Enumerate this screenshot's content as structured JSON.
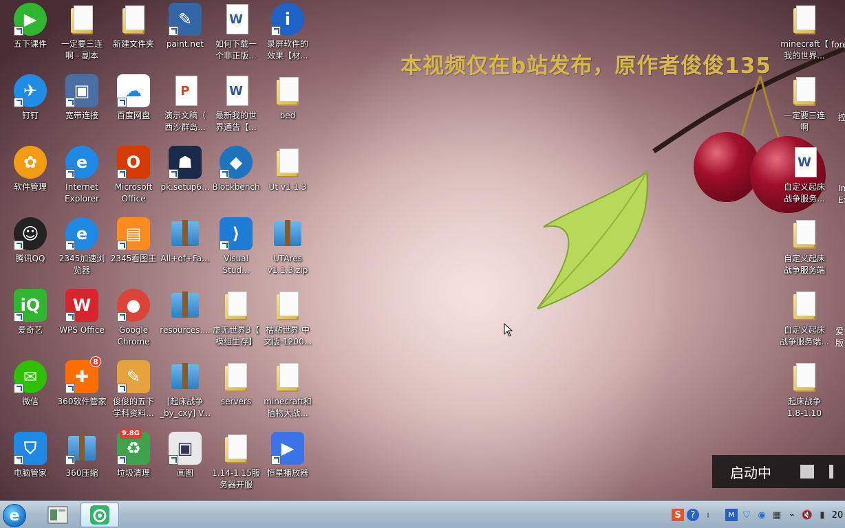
{
  "watermark": "本视频仅在b站发布，原作者俊俊135",
  "desktop_icons": [
    {
      "label": "五下课件"
    },
    {
      "label": "一定要三连\n啊 - 副本"
    },
    {
      "label": "新建文件夹"
    },
    {
      "label": "paint.net"
    },
    {
      "label": "如何下载一\n个非正版..."
    },
    {
      "label": "录屏软件的\n效果【材..."
    },
    {
      "label": "钉钉"
    },
    {
      "label": "宽带连接"
    },
    {
      "label": "百度网盘"
    },
    {
      "label": "演示文稿（\n西沙群岛..."
    },
    {
      "label": "最新我的世\n界通告【..."
    },
    {
      "label": "bed"
    },
    {
      "label": "软件管理"
    },
    {
      "label": "Internet\nExplorer"
    },
    {
      "label": "Microsoft\nOffice"
    },
    {
      "label": "pk.setup6..."
    },
    {
      "label": "Blockbench"
    },
    {
      "label": "Ut v1.1.3"
    },
    {
      "label": "腾讯QQ"
    },
    {
      "label": "2345加速浏\n览器"
    },
    {
      "label": "2345看图王"
    },
    {
      "label": "All+of+Fa..."
    },
    {
      "label": "Visual\nStud..."
    },
    {
      "label": "UTAres\nv1.1.3.zip"
    },
    {
      "label": "爱奇艺"
    },
    {
      "label": "WPS Office"
    },
    {
      "label": "Google\nChrome"
    },
    {
      "label": "resources...."
    },
    {
      "label": "虚无世界3【\n模组生存】"
    },
    {
      "label": "枯粘世界 中\n文版-1200..."
    },
    {
      "label": "微信"
    },
    {
      "label": "360软件管家"
    },
    {
      "label": "俊俊的五下\n学科资料..."
    },
    {
      "label": "[起床战争\n_by_cxy] V..."
    },
    {
      "label": "servers"
    },
    {
      "label": "minecraft和\n植物大战..."
    },
    {
      "label": "电脑管家"
    },
    {
      "label": "360压缩"
    },
    {
      "label": "垃圾清理"
    },
    {
      "label": "画图"
    },
    {
      "label": "1.14-1.15服\n务器开服"
    },
    {
      "label": "恒星播放器"
    }
  ],
  "right_icons": [
    {
      "label": "minecraft【\n我的世界..."
    },
    {
      "label": "一定要三连\n啊"
    },
    {
      "label": "自定义起床\n战争服务..."
    },
    {
      "label": "自定义起床\n战争服务端"
    },
    {
      "label": "自定义起床\n战争服务端..."
    },
    {
      "label": "起床战争\n1.8-1.10"
    }
  ],
  "edge_labels": [
    "fore",
    "控",
    "In\nEx",
    "爱\n版"
  ],
  "badges": {
    "software_manager": "8",
    "cleaner": "9.8G"
  },
  "recorder": {
    "status": "启动中"
  },
  "taskbar": {
    "clock_partial": "20"
  },
  "colors": {
    "watermark": "#d6b84a",
    "taskbar": "#a9bccd"
  }
}
